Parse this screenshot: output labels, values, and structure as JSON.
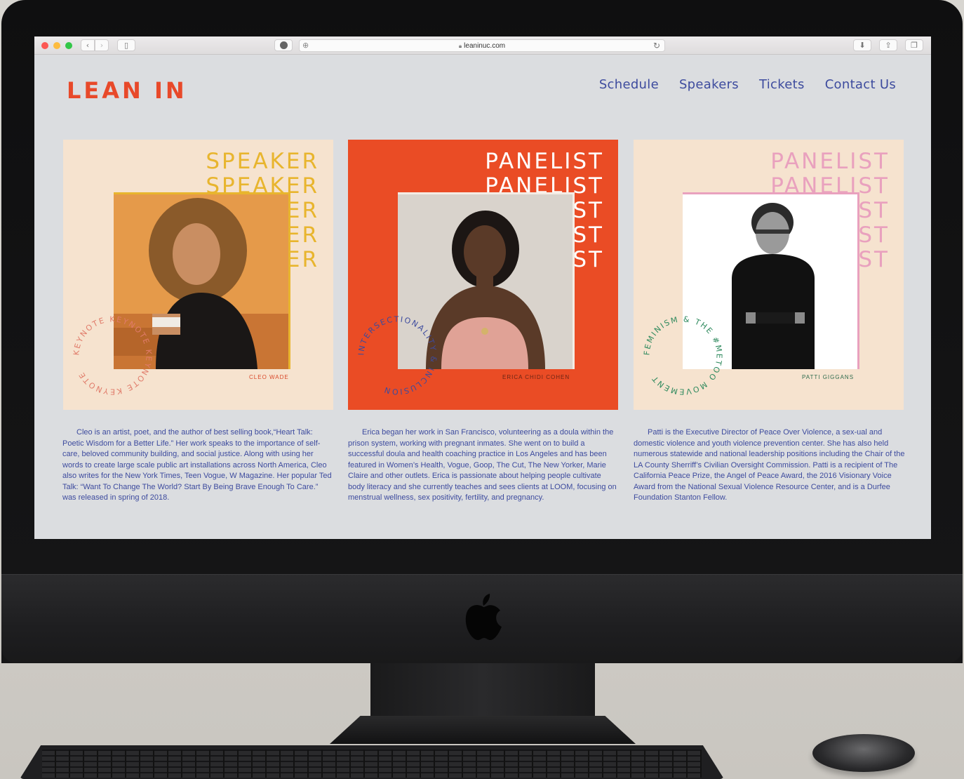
{
  "browser": {
    "url": "leaninuc.com"
  },
  "site": {
    "logo": "LEAN IN",
    "nav": [
      "Schedule",
      "Speakers",
      "Tickets",
      "Contact Us"
    ]
  },
  "cards": [
    {
      "role": "SPEAKER",
      "name": "Cleo Wade",
      "badge": "KEYNOTE KEYNOTE KEYNOTE KEYNOTE",
      "bio": "Cleo is an artist, poet, and the author of best selling book,“Heart Talk: Poetic Wisdom for a Better Life.” Her work speaks to the importance of self-care, beloved community building, and social justice. Along with using her words to create large scale public art installations across North America, Cleo also writes for the New York Times, Teen Vogue, W Magazine. Her popular Ted Talk: “Want To Change The World? Start By Being Brave Enough To Care.” was released in spring of 2018."
    },
    {
      "role": "PANELIST",
      "name": "Erica Chidi Cohen",
      "badge": "INTERSECTIONALITY & INCLUSION",
      "bio": "Erica began her work in San Francisco, volunteering as a doula within the prison system, working with pregnant inmates. She went on to build a successful doula and health coaching practice in Los Angeles and has been featured in Women’s Health, Vogue, Goop, The Cut, The New Yorker, Marie Claire and other outlets. Erica is passionate about helping people cultivate body literacy and she currently teaches and sees clients at LOOM, focusing on menstrual wellness, sex positivity, fertility, and pregnancy."
    },
    {
      "role": "PANELIST",
      "name": "PATTI GIGGANS",
      "badge": "FEMINISM & THE #METOO MOVEMENT",
      "bio": "Patti is the Executive Director of Peace Over Violence, a sex-ual and domestic violence and youth violence prevention center. She has also held numerous statewide and national leadership positions including the Chair of the LA County Sherriff’s Civilian Oversight Commission. Patti is a recipient of The California Peace Prize, the Angel of Peace Award, the 2016 Visionary Voice Award from the National Sexual Violence Resource Center, and is a Durfee Foundation Stanton Fellow."
    }
  ],
  "colors": {
    "brand_red": "#e8492a",
    "nav_blue": "#3d4b9e",
    "speaker_yellow": "#e8b52e",
    "panel_orange": "#ea4c25",
    "panel_pink": "#e9a1be",
    "card_cream": "#f6e3cf"
  }
}
